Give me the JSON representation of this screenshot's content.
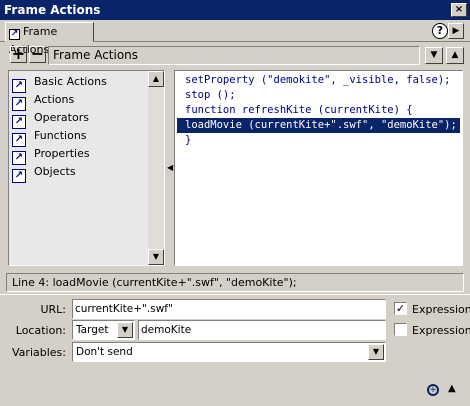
{
  "window": {
    "title": "Frame Actions",
    "close_glyph": "×"
  },
  "tab": {
    "label": "Frame Actions",
    "help_glyph": "?",
    "menu_glyph": "▶"
  },
  "toolbar": {
    "add_glyph": "+",
    "remove_glyph": "−",
    "path_label": "Frame Actions",
    "nav_down_glyph": "▼",
    "nav_up_glyph": "▲"
  },
  "toolbox": {
    "items": [
      {
        "label": "Basic Actions",
        "icon": "book-icon"
      },
      {
        "label": "Actions",
        "icon": "book-icon"
      },
      {
        "label": "Operators",
        "icon": "book-icon"
      },
      {
        "label": "Functions",
        "icon": "book-icon"
      },
      {
        "label": "Properties",
        "icon": "book-icon"
      },
      {
        "label": "Objects",
        "icon": "book-icon"
      }
    ],
    "scroll_up_glyph": "▲",
    "scroll_down_glyph": "▼",
    "splitter_glyph": "◀"
  },
  "code": {
    "lines": [
      "setProperty (\"demokite\", _visible, false);",
      "stop ();",
      "function refreshKite (currentKite) {",
      "loadMovie (currentKite+\".swf\", \"demoKite\");",
      "}"
    ],
    "selected_line_index": 3
  },
  "status": {
    "text": "Line 4: loadMovie (currentKite+\".swf\", \"demoKite\");"
  },
  "params": {
    "url_label": "URL:",
    "url_value": "currentKite+\".swf\"",
    "url_expression_checked": true,
    "location_label": "Location:",
    "location_type": "Target",
    "location_value": "demoKite",
    "location_expression_checked": false,
    "variables_label": "Variables:",
    "variables_value": "Don't send",
    "expression_label": "Expression",
    "check_glyph": "✓",
    "dropdown_glyph": "▼"
  },
  "footer": {
    "target_glyph": "+",
    "collapse_glyph": "▲"
  },
  "colors": {
    "title_bar": "#0a246a",
    "selection": "#0a246a",
    "code_text": "#000080",
    "panel_bg": "#d4d0c8"
  }
}
